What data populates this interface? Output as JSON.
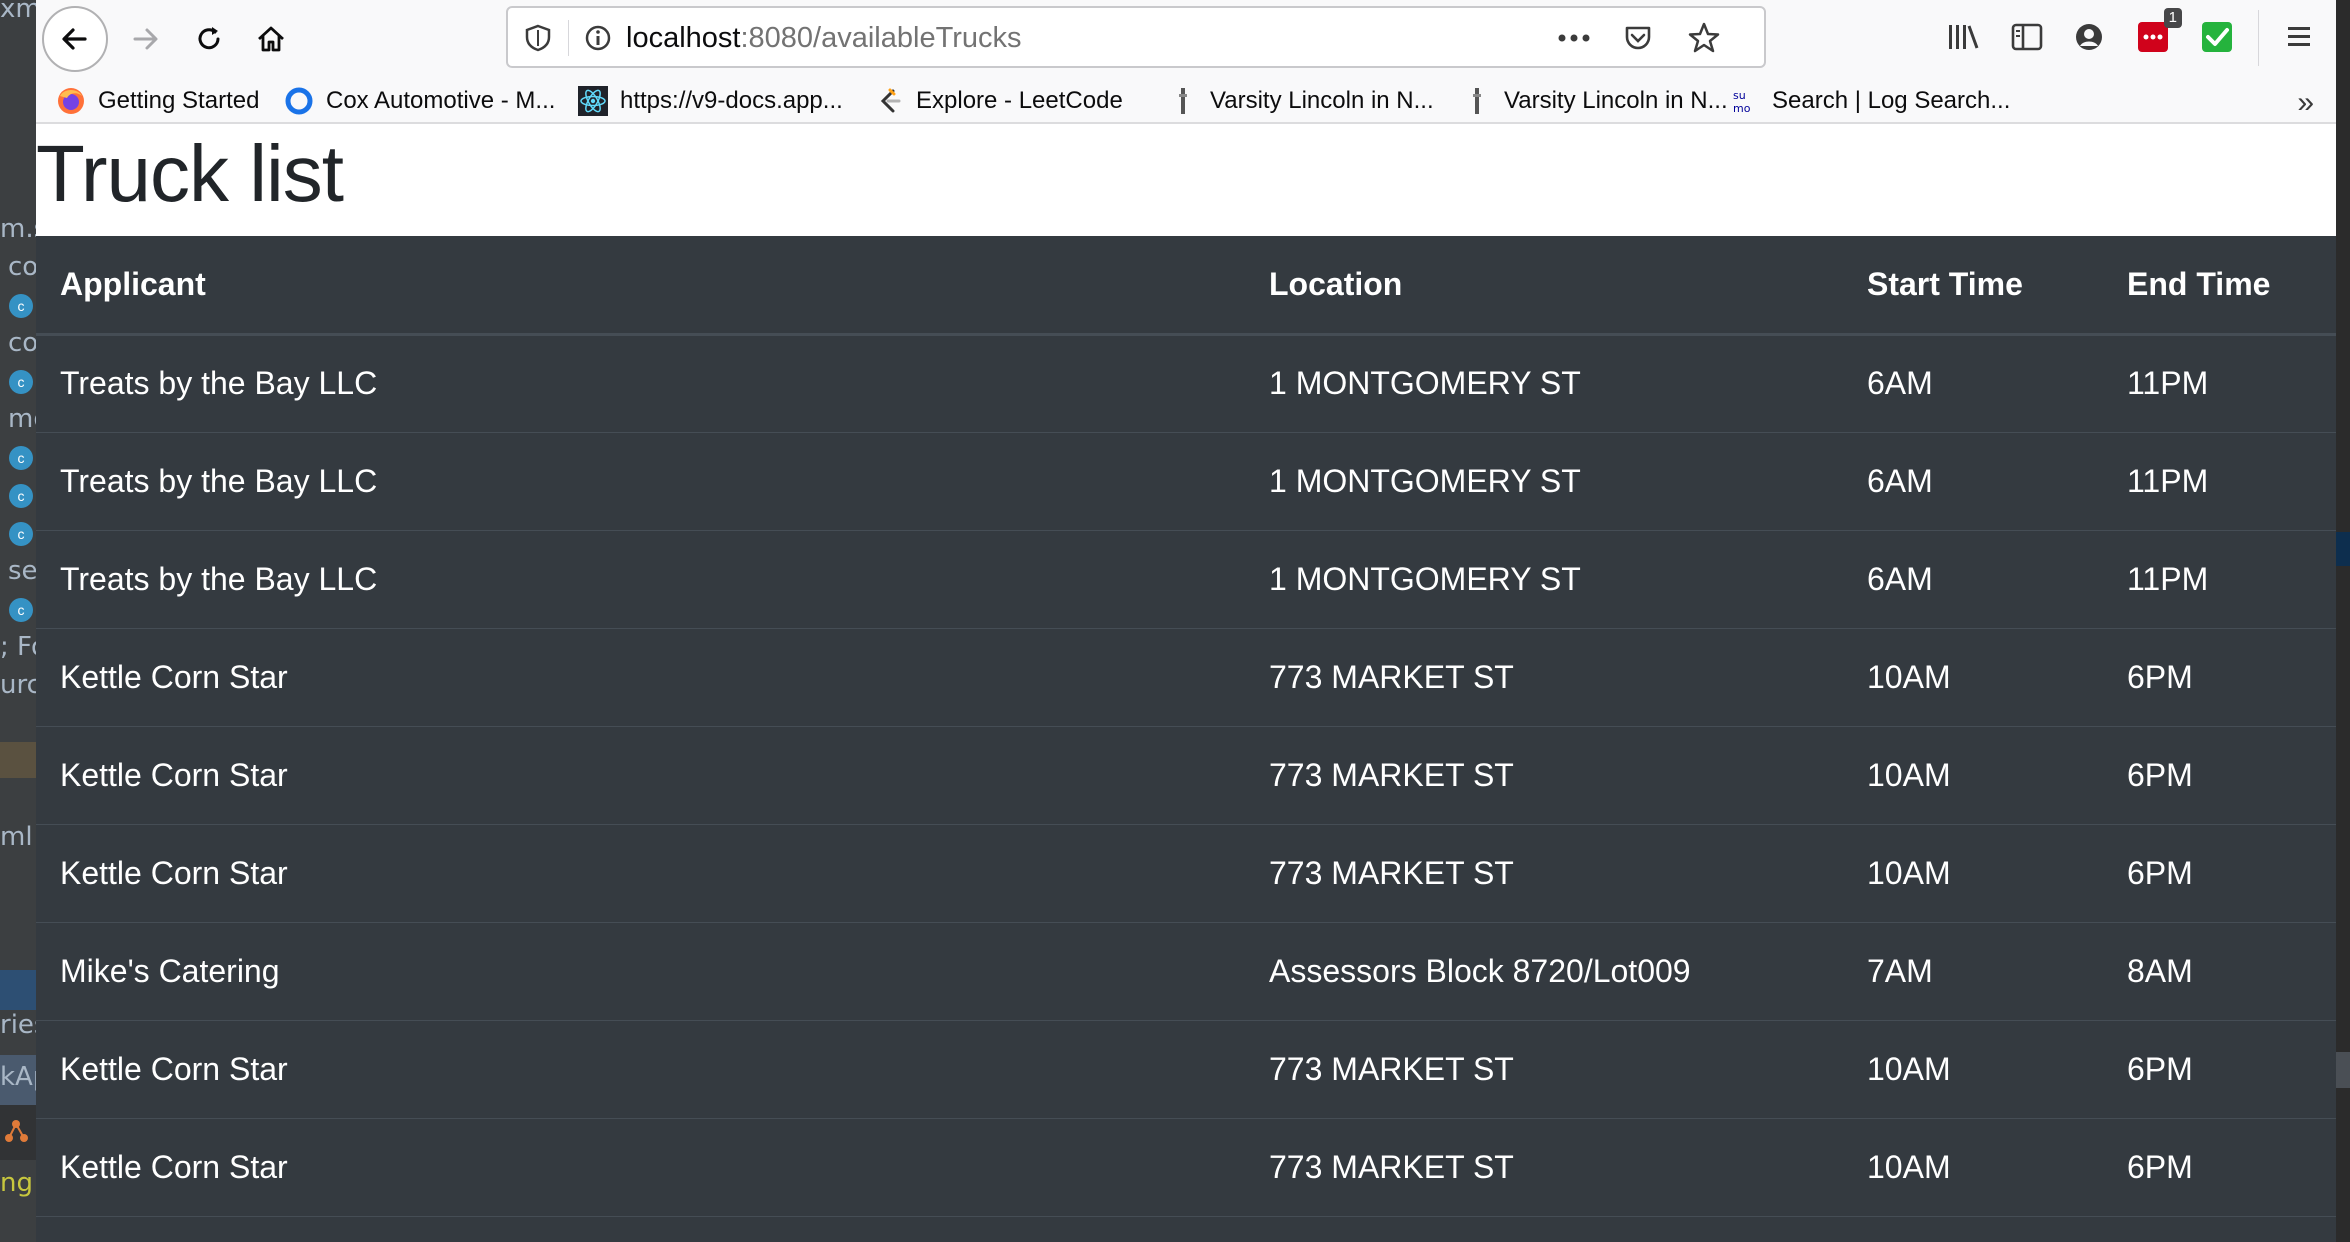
{
  "ide_fragments": [
    "xm",
    "m.s",
    "co",
    "co",
    "mo",
    "se",
    "; Fo",
    "urce",
    "ml",
    "ries",
    "kAp",
    "ng"
  ],
  "browser": {
    "url_host": "localhost",
    "url_path": ":8080/availableTrucks",
    "badge_count": "1",
    "bookmarks": [
      {
        "label": "Getting Started",
        "icon": "firefox-icon"
      },
      {
        "label": "Cox Automotive - M...",
        "icon": "circle-icon"
      },
      {
        "label": "https://v9-docs.app...",
        "icon": "react-icon"
      },
      {
        "label": "Explore - LeetCode",
        "icon": "leetcode-icon"
      },
      {
        "label": "Varsity Lincoln in N...",
        "icon": "page-icon"
      },
      {
        "label": "Varsity Lincoln in N...",
        "icon": "page-icon"
      },
      {
        "label": "Search | Log Search...",
        "icon": "sumo-icon"
      }
    ]
  },
  "page": {
    "title": "Truck list",
    "table": {
      "headers": [
        "Applicant",
        "Location",
        "Start Time",
        "End Time"
      ],
      "rows": [
        [
          "Treats by the Bay LLC",
          "1 MONTGOMERY ST",
          "6AM",
          "11PM"
        ],
        [
          "Treats by the Bay LLC",
          "1 MONTGOMERY ST",
          "6AM",
          "11PM"
        ],
        [
          "Treats by the Bay LLC",
          "1 MONTGOMERY ST",
          "6AM",
          "11PM"
        ],
        [
          "Kettle Corn Star",
          "773 MARKET ST",
          "10AM",
          "6PM"
        ],
        [
          "Kettle Corn Star",
          "773 MARKET ST",
          "10AM",
          "6PM"
        ],
        [
          "Kettle Corn Star",
          "773 MARKET ST",
          "10AM",
          "6PM"
        ],
        [
          "Mike's Catering",
          "Assessors Block 8720/Lot009",
          "7AM",
          "8AM"
        ],
        [
          "Kettle Corn Star",
          "773 MARKET ST",
          "10AM",
          "6PM"
        ],
        [
          "Kettle Corn Star",
          "773 MARKET ST",
          "10AM",
          "6PM"
        ]
      ]
    }
  }
}
